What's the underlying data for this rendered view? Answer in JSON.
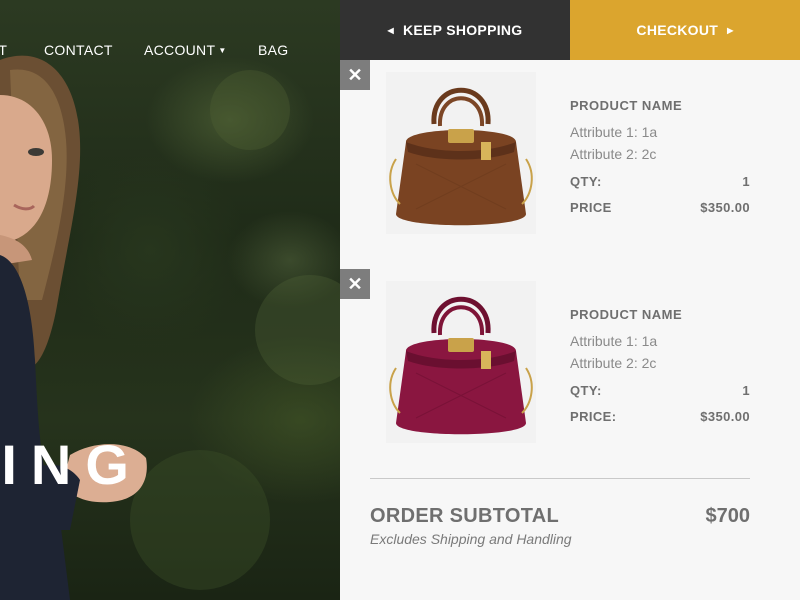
{
  "nav": {
    "about": "UT",
    "contact": "CONTACT",
    "account": "ACCOUNT",
    "bag": "BAG"
  },
  "hero": {
    "word": "PING"
  },
  "cart": {
    "keep_shopping": "KEEP SHOPPING",
    "checkout": "CHECKOUT",
    "remove_glyph": "✕",
    "items": [
      {
        "name": "PRODUCT NAME",
        "attr1": "Attribute 1: 1a",
        "attr2": "Attribute 2: 2c",
        "qty_label": "QTY:",
        "qty": "1",
        "price_label": "PRICE",
        "price": "$350.00",
        "color": "#7a4322"
      },
      {
        "name": "PRODUCT NAME",
        "attr1": "Attribute 1: 1a",
        "attr2": "Attribute 2: 2c",
        "qty_label": "QTY:",
        "qty": "1",
        "price_label": "PRICE:",
        "price": "$350.00",
        "color": "#8a1640"
      }
    ],
    "subtotal_label": "ORDER SUBTOTAL",
    "subtotal_value": "$700",
    "subtotal_note": "Excludes Shipping and Handling"
  },
  "colors": {
    "keep_shopping_bg": "#323232",
    "checkout_bg": "#dba52e",
    "panel_bg": "#f7f7f7",
    "remove_bg": "#7d7d7d"
  }
}
